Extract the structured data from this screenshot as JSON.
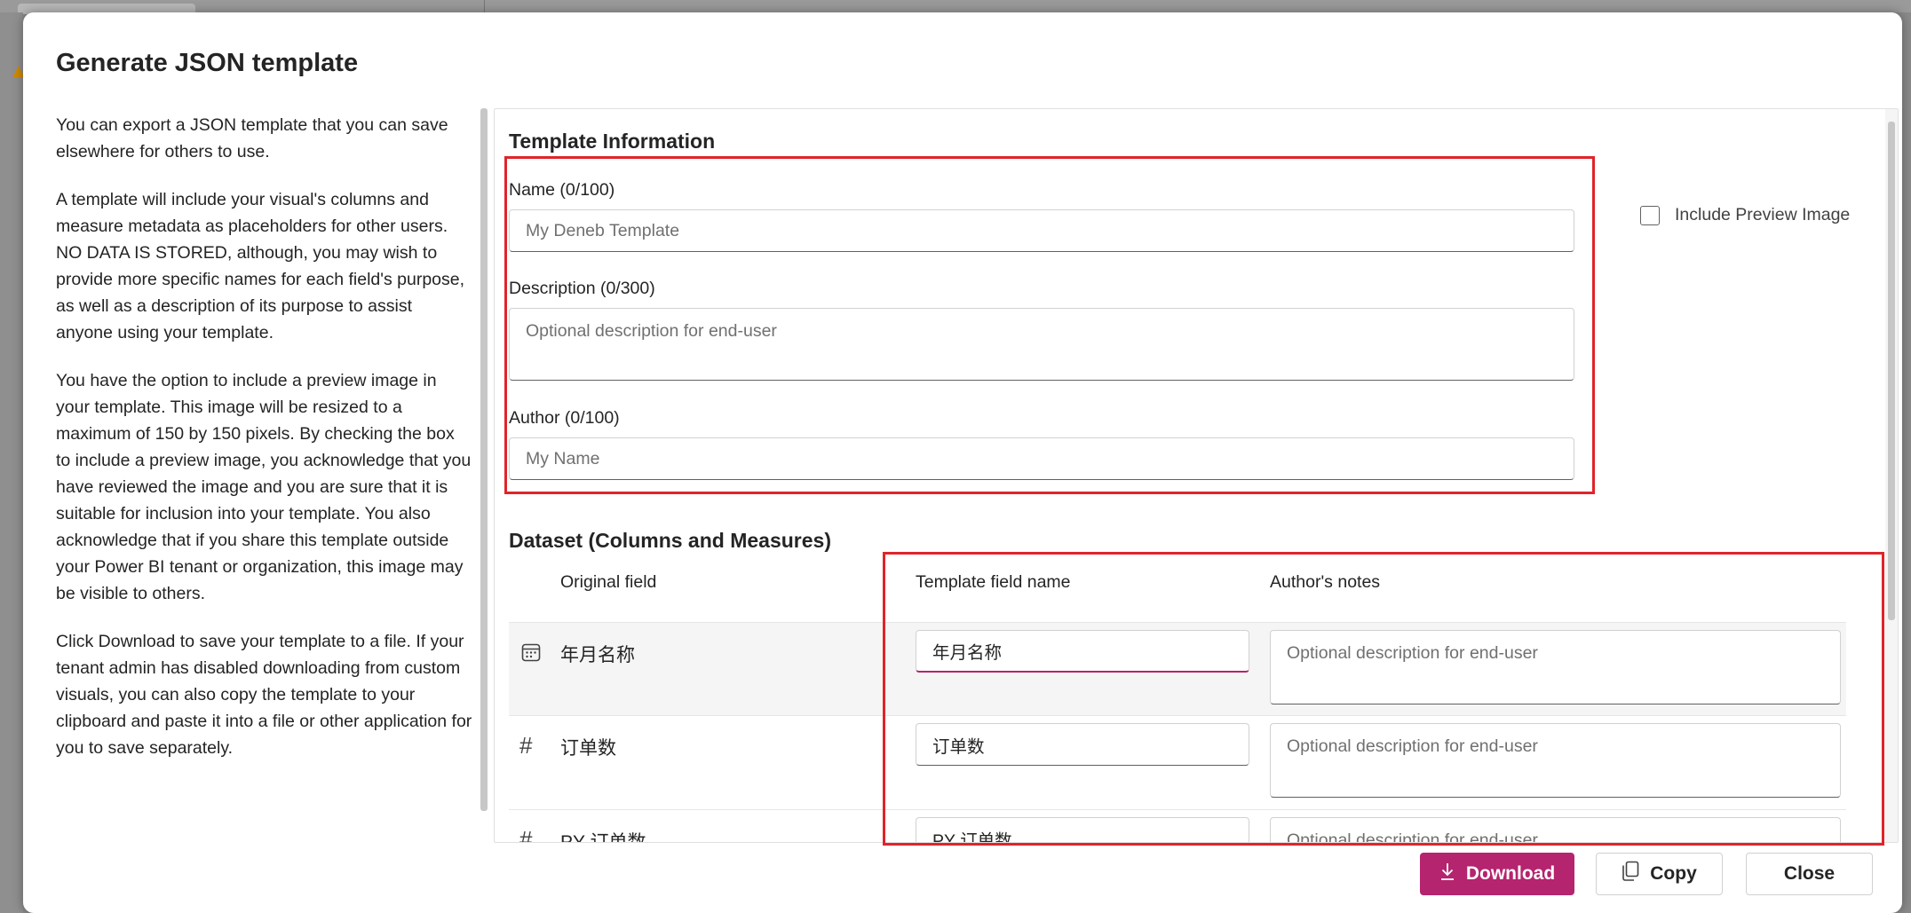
{
  "dialog": {
    "title": "Generate JSON template",
    "help_paragraphs": [
      "You can export a JSON template that you can save elsewhere for others to use.",
      "A template will include your visual's columns and measure metadata as placeholders for other users. NO DATA IS STORED, although, you may wish to provide more specific names for each field's purpose, as well as a description of its purpose to assist anyone using your template.",
      "You have the option to include a preview image in your template. This image will be resized to a maximum of 150 by 150 pixels. By checking the box to include a preview image, you acknowledge that you have reviewed the image and you are sure that it is suitable for inclusion into your template. You also acknowledge that if you share this template outside your Power BI tenant or organization, this image may be visible to others.",
      "Click Download to save your template to a file. If your tenant admin has disabled downloading from custom visuals, you can also copy the template to your clipboard and paste it into a file or other application for you to save separately."
    ]
  },
  "template_info": {
    "title": "Template Information",
    "name_label": "Name (0/100)",
    "name_placeholder": "My Deneb Template",
    "description_label": "Description (0/300)",
    "description_placeholder": "Optional description for end-user",
    "author_label": "Author (0/100)",
    "author_placeholder": "My Name",
    "include_preview_label": "Include Preview Image",
    "include_preview_checked": false
  },
  "dataset": {
    "title": "Dataset (Columns and Measures)",
    "headers": {
      "original": "Original field",
      "template": "Template field name",
      "notes": "Author's notes"
    },
    "rows": [
      {
        "icon": "calendar-icon",
        "original": "年月名称",
        "template_value": "年月名称",
        "notes_placeholder": "Optional description for end-user"
      },
      {
        "icon": "hash-icon",
        "original": "订单数",
        "template_value": "订单数",
        "notes_placeholder": "Optional description for end-user"
      },
      {
        "icon": "hash-icon",
        "original": "PY 订单数",
        "template_value": "PY 订单数",
        "notes_placeholder": "Optional description for end-user"
      }
    ]
  },
  "buttons": {
    "download": "Download",
    "copy": "Copy",
    "close": "Close"
  },
  "colors": {
    "accent": "#b5246e",
    "highlight": "#e0242a"
  }
}
